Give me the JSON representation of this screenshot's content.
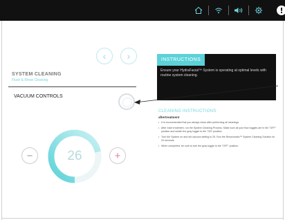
{
  "topbar": {
    "icons": [
      "home-icon",
      "wifi-icon",
      "volume-icon",
      "settings-icon",
      "alert-icon"
    ],
    "alert_glyph": "!"
  },
  "nav": {
    "prev_glyph": "‹",
    "next_glyph": "›"
  },
  "section": {
    "title": "SYSTEM CLEANING",
    "subtitle": "Flush & Rinse Cleaning"
  },
  "vacuum": {
    "label": "VACUUM CONTROLS"
  },
  "dial": {
    "value": "26",
    "level": 0.72,
    "minus": "−",
    "plus": "+"
  },
  "instructions": {
    "tab_label": "INSTRUCTIONS",
    "text": "Ensure your HydraFacial™ System is operating at optimal levels with routine system cleaning."
  },
  "cleaning": {
    "title": "CLEANING INSTRUCTIONS",
    "subtitle": "aftertreatment",
    "steps": [
      "It is recommended that you always clean after performing all cleanings.",
      "After each treatment, run the System Cleaning Process. Make sure all your flow toggles are in the \"OFF\" position and switch the gray toggle to the \"ON\" position.",
      "Turn the System on and set vacuum setting to 25. Run the Rinseomatic™ System Cleaning Solution for 20 seconds.",
      "When completed, be sure to turn the gray toggle to the \"OFF\" position."
    ]
  },
  "colors": {
    "accent": "#5cd2d9",
    "dark": "#111111",
    "plus": "#e07f9a"
  }
}
